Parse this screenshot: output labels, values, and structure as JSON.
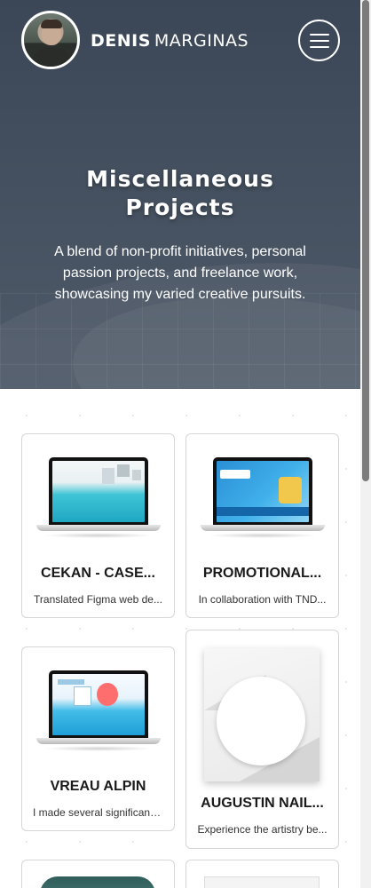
{
  "header": {
    "brand_first": "DENIS",
    "brand_last": "MARGINAS",
    "avatar_icon": "profile-photo",
    "menu_icon": "hamburger-icon"
  },
  "hero": {
    "title": "Miscellaneous Projects",
    "description": "A blend of non-profit initiatives, personal passion projects, and freelance work, showcasing my varied creative pursuits."
  },
  "projects": [
    {
      "title": "CEKAN - CASE...",
      "description": "Translated Figma web de..."
    },
    {
      "title": "PROMOTIONAL...",
      "description": "In collaboration with TND..."
    },
    {
      "title": "VREAU ALPIN",
      "description": "I made several significant ..."
    },
    {
      "title": "AUGUSTIN NAIL...",
      "description": "Experience the artistry be..."
    }
  ],
  "colors": {
    "hero_bg": "#3f4b5b",
    "card_border": "#d6d6d6",
    "accent_cyan": "#1fa7c3"
  }
}
